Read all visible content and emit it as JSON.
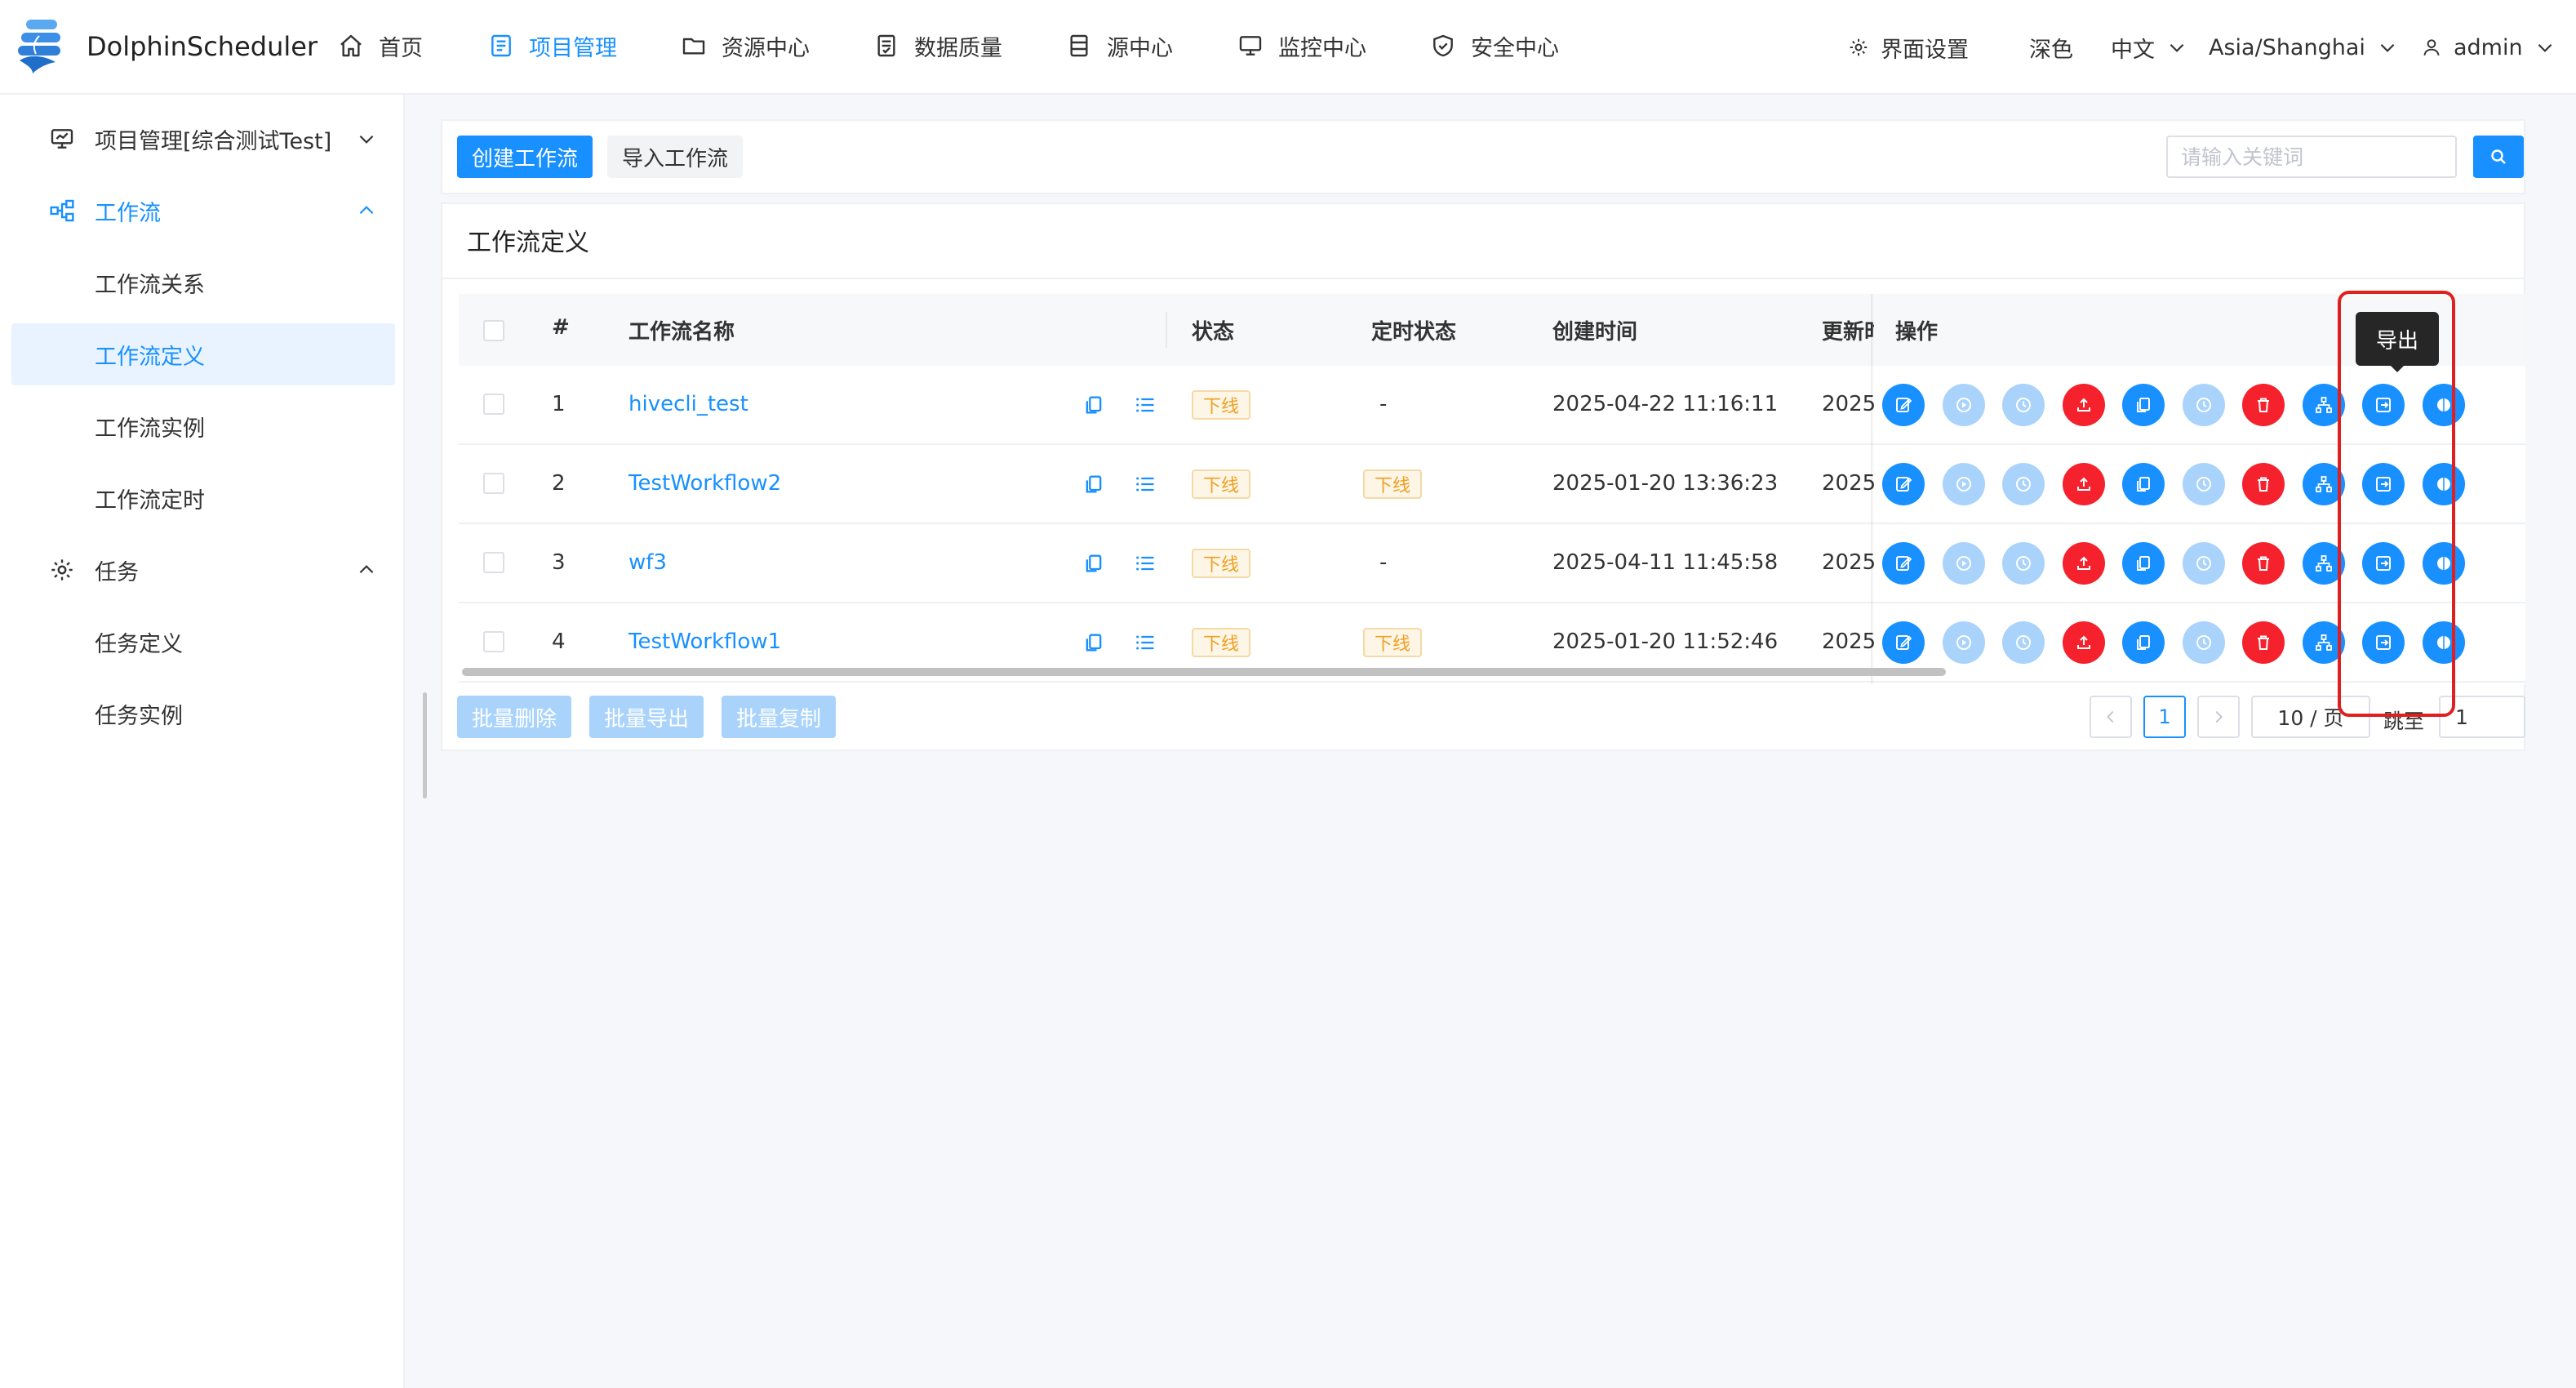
{
  "app": {
    "name": "DolphinScheduler"
  },
  "topnav": {
    "items": [
      {
        "label": "首页",
        "icon": "home-icon"
      },
      {
        "label": "项目管理",
        "icon": "project-icon",
        "active": true
      },
      {
        "label": "资源中心",
        "icon": "folder-icon"
      },
      {
        "label": "数据质量",
        "icon": "data-quality-icon"
      },
      {
        "label": "源中心",
        "icon": "datasource-icon"
      },
      {
        "label": "监控中心",
        "icon": "monitor-icon"
      },
      {
        "label": "安全中心",
        "icon": "shield-icon"
      }
    ],
    "ui_settings": "界面设置",
    "theme": "深色",
    "language": "中文",
    "timezone": "Asia/Shanghai",
    "user": "admin"
  },
  "sidebar": {
    "project": "项目管理[综合测试Test]",
    "workflow_group": "工作流",
    "workflow_items": [
      "工作流关系",
      "工作流定义",
      "工作流实例",
      "工作流定时"
    ],
    "task_group": "任务",
    "task_items": [
      "任务定义",
      "任务实例"
    ]
  },
  "toolbar": {
    "create_label": "创建工作流",
    "import_label": "导入工作流",
    "search_placeholder": "请输入关键词"
  },
  "card": {
    "title": "工作流定义"
  },
  "table": {
    "headers": {
      "index": "#",
      "name": "工作流名称",
      "status": "状态",
      "schedule_status": "定时状态",
      "create_time": "创建时间",
      "update_time": "更新时",
      "ops": "操作"
    },
    "rows": [
      {
        "index": "1",
        "name": "hivecli_test",
        "status": "下线",
        "schedule_status": "-",
        "schedule_is_tag": false,
        "create_time": "2025-04-22 11:16:11",
        "update_time": "2025"
      },
      {
        "index": "2",
        "name": "TestWorkflow2",
        "status": "下线",
        "schedule_status": "下线",
        "schedule_is_tag": true,
        "create_time": "2025-01-20 13:36:23",
        "update_time": "2025"
      },
      {
        "index": "3",
        "name": "wf3",
        "status": "下线",
        "schedule_status": "-",
        "schedule_is_tag": false,
        "create_time": "2025-04-11 11:45:58",
        "update_time": "2025"
      },
      {
        "index": "4",
        "name": "TestWorkflow1",
        "status": "下线",
        "schedule_status": "下线",
        "schedule_is_tag": true,
        "create_time": "2025-01-20 11:52:46",
        "update_time": "2025"
      }
    ],
    "ops": [
      {
        "name": "edit",
        "icon": "edit-icon",
        "color": "#1890ff"
      },
      {
        "name": "run",
        "icon": "run-icon",
        "color": "#a9d3fb"
      },
      {
        "name": "timing",
        "icon": "clock-icon",
        "color": "#a9d3fb"
      },
      {
        "name": "online",
        "icon": "upload-icon",
        "color": "#f5222d"
      },
      {
        "name": "copy",
        "icon": "copy-icon",
        "color": "#1890ff"
      },
      {
        "name": "timing-manage",
        "icon": "clock-icon",
        "color": "#a9d3fb"
      },
      {
        "name": "delete",
        "icon": "delete-icon",
        "color": "#f5222d"
      },
      {
        "name": "tree",
        "icon": "tree-icon",
        "color": "#1890ff"
      },
      {
        "name": "export",
        "icon": "export-icon",
        "color": "#1890ff"
      },
      {
        "name": "version",
        "icon": "version-icon",
        "color": "#1890ff"
      }
    ]
  },
  "footer": {
    "batch_delete": "批量删除",
    "batch_export": "批量导出",
    "batch_copy": "批量复制",
    "current_page": "1",
    "page_size": "10 / 页",
    "jump_label": "跳至",
    "jump_value": "1"
  },
  "tooltip": {
    "text": "导出"
  },
  "colors": {
    "primary": "#1890ff",
    "danger": "#f5222d",
    "highlight": "#e02020"
  }
}
